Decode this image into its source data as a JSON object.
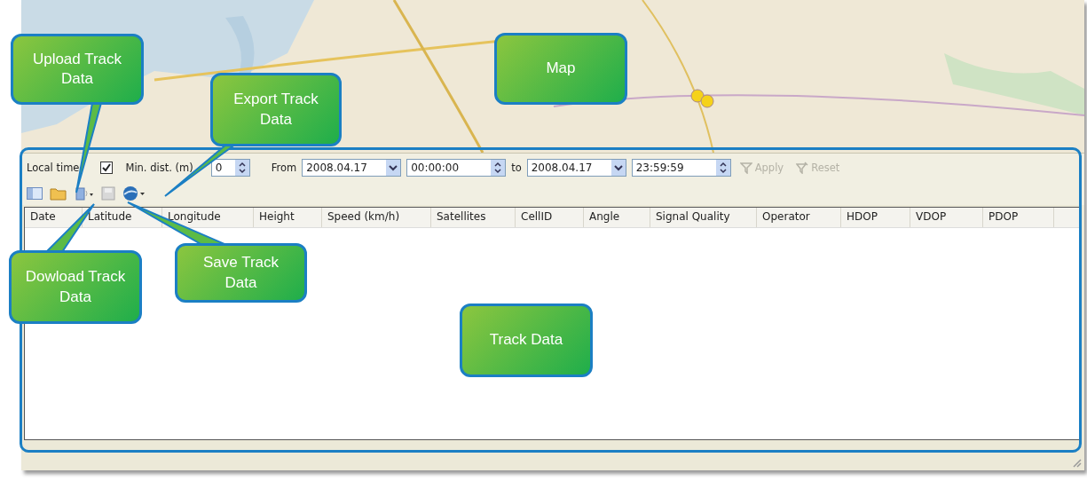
{
  "filter_bar": {
    "local_time": {
      "label": "Local time",
      "checked": true
    },
    "min_dist": {
      "label": "Min. dist. (m)",
      "value": "0"
    },
    "from_label": "From",
    "from_date": "2008.04.17",
    "from_time": "00:00:00",
    "to_label": "to",
    "to_date": "2008.04.17",
    "to_time": "23:59:59",
    "apply": {
      "label": "Apply",
      "disabled": true
    },
    "reset": {
      "label": "Reset",
      "disabled": true
    }
  },
  "table": {
    "columns": [
      "Date",
      "Latitude",
      "Longitude",
      "Height",
      "Speed (km/h)",
      "Satellites",
      "CellID",
      "Angle",
      "Signal Quality",
      "Operator",
      "HDOP",
      "VDOP",
      "PDOP"
    ]
  },
  "callouts": [
    {
      "label": "Upload Track Data"
    },
    {
      "label": "Export Track Data"
    },
    {
      "label": "Map"
    },
    {
      "label": "Dowload Track Data"
    },
    {
      "label": "Save Track Data"
    },
    {
      "label": "Track Data"
    }
  ]
}
